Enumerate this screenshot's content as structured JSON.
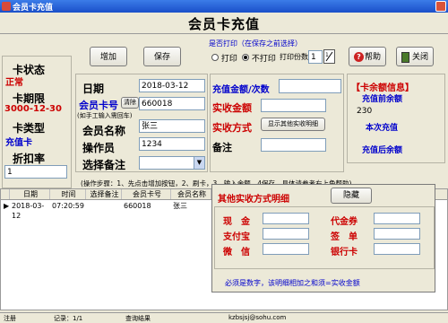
{
  "window": {
    "title": "会员卡充值"
  },
  "header": {
    "title": "会员卡充值"
  },
  "print": {
    "question": "是否打印（在保存之前选择）",
    "opt_print": "打印",
    "opt_noprint": "不打印",
    "copies_label": "打印份数",
    "copies_value": "1"
  },
  "toolbar": {
    "add": "增加",
    "save": "保存",
    "help": "帮助",
    "close": "关闭"
  },
  "card_status": {
    "status_label": "卡状态",
    "status_value": "正常",
    "expiry_label": "卡期限",
    "expiry_value": "3000-12-30",
    "type_label": "卡类型",
    "type_value": "充值卡",
    "discount_label": "折扣率",
    "discount_value": "1"
  },
  "form": {
    "date_label": "日期",
    "date_value": "2018-03-12",
    "card_label": "会员卡号",
    "clear_btn": "清除",
    "card_value": "660018",
    "card_hint": "(如手工输入需回车)",
    "name_label": "会员名称",
    "name_value": "张三",
    "operator_label": "操作员",
    "operator_value": "1234",
    "remark_label": "选择备注"
  },
  "recharge": {
    "amount_label": "充值金额/次数",
    "actual_label": "实收金额",
    "method_label": "实收方式",
    "method_btn": "显示其他实收明细",
    "note_label": "备注"
  },
  "balance": {
    "title": "【卡余额信息】",
    "before_label": "充值前余额",
    "before_value": "230",
    "this_label": "本次充值",
    "after_label": "充值后余额"
  },
  "steps": "(操作步骤：1、先点击增加按钮，2、刷卡，3、输入金额、4保存，具体请参考右上角帮助)",
  "grid": {
    "columns": [
      "日期",
      "时间",
      "选择备注",
      "会员卡号",
      "会员名称"
    ],
    "rows": [
      [
        "2018-03-12",
        "07:20:59",
        "",
        "660018",
        "张三"
      ]
    ]
  },
  "detail": {
    "title": "其他实收方式明细",
    "hide_btn": "隐藏",
    "cash": "现　金",
    "alipay": "支付宝",
    "wechat": "微　信",
    "voucher": "代金券",
    "sign": "签　单",
    "bankcard": "银行卡",
    "footer": "必须是数字，该明细相加之和须=实收金额"
  },
  "status": {
    "s1": "注册",
    "s2": "记录：1/1",
    "s3": "查询结果",
    "s4": "kzbsjsj@sohu.com"
  },
  "colors": {
    "red": "#cc0000",
    "blue": "#0000cc",
    "title_bar": "#1a4fc9"
  },
  "icons": [
    "app-icon",
    "help-icon",
    "close-door-icon",
    "calculator-icon",
    "row-pointer-icon"
  ]
}
